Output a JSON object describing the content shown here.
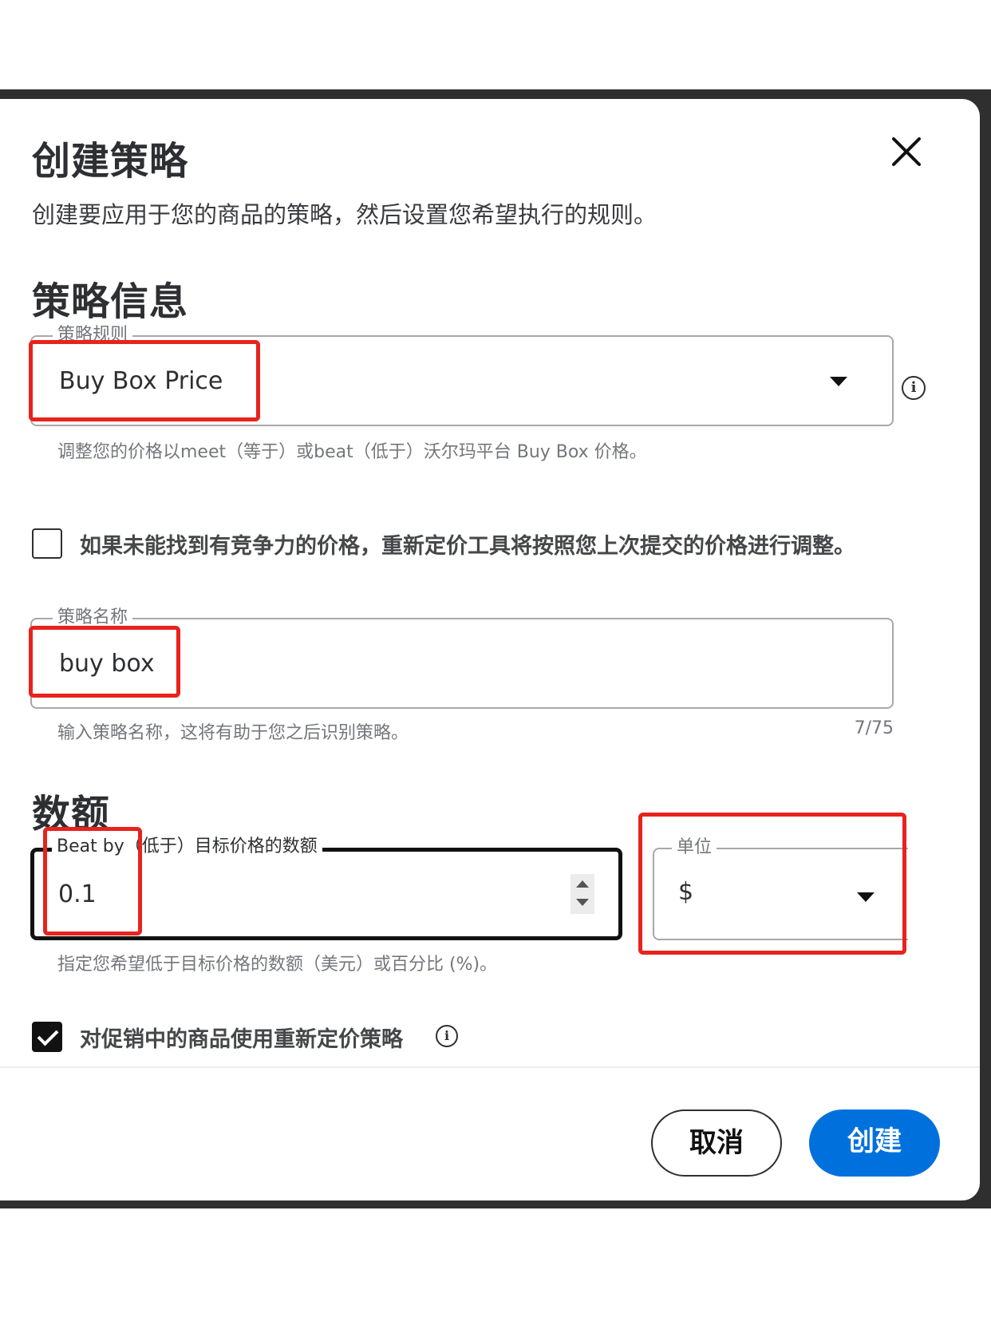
{
  "modal": {
    "title": "创建策略",
    "subtitle": "创建要应用于您的商品的策略，然后设置您希望执行的规则。",
    "close_icon": "close-icon"
  },
  "strategy_info": {
    "heading": "策略信息",
    "rule_field": {
      "label": "策略规则",
      "value": "Buy Box Price",
      "helper": "调整您的价格以meet（等于）或beat（低于）沃尔玛平台 Buy Box 价格。",
      "info_icon": "i"
    },
    "fallback_checkbox": {
      "label": "如果未能找到有竞争力的价格，重新定价工具将按照您上次提交的价格进行调整。",
      "checked": false
    },
    "name_field": {
      "label": "策略名称",
      "value": "buy box",
      "helper": "输入策略名称，这将有助于您之后识别策略。",
      "counter": "7/75"
    }
  },
  "amount": {
    "heading": "数额",
    "amount_field": {
      "label": "Beat by（低于）目标价格的数额",
      "value": "0.1",
      "helper": "指定您希望低于目标价格的数额（美元）或百分比 (%)。"
    },
    "unit_field": {
      "label": "单位",
      "value": "$"
    },
    "promo_checkbox": {
      "label": "对促销中的商品使用重新定价策略",
      "checked": true,
      "info_icon": "i"
    }
  },
  "footer": {
    "cancel_label": "取消",
    "create_label": "创建"
  },
  "colors": {
    "primary": "#0071dc",
    "highlight": "#e8221c",
    "text": "#2e2f32",
    "helper_text": "#74767c"
  }
}
